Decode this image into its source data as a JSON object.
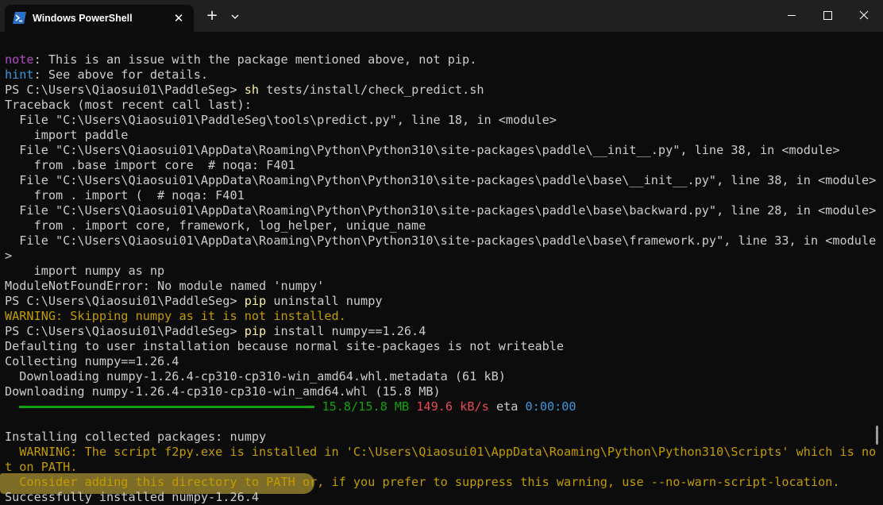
{
  "window": {
    "tab_title": "Windows PowerShell",
    "tab_icon": "powershell-icon",
    "new_tab_label": "+",
    "tab_close_label": "✕",
    "controls": [
      "minimize-icon",
      "maximize-icon",
      "close-icon"
    ]
  },
  "colors": {
    "background": "#0c0c0c",
    "titlebar": "#202020",
    "text": "#cccccc",
    "prompt_keyword": "#f9f1a5",
    "warning": "#c19c00",
    "note": "#b148c6",
    "hint": "#3a96dd",
    "progress": "#13a10e",
    "speed": "#e74856",
    "highlight": "#c4aa3c"
  },
  "terminal": {
    "note_label": "note",
    "note_text": ": This is an issue with the package mentioned above, not pip.",
    "hint_label": "hint",
    "hint_text": ": See above for details.",
    "prompt": "PS C:\\Users\\Qiaosui01\\PaddleSeg> ",
    "cmd1_keyword": "sh",
    "cmd1_args": " tests/install/check_predict.sh",
    "traceback": [
      "Traceback (most recent call last):",
      "  File \"C:\\Users\\Qiaosui01\\PaddleSeg\\tools\\predict.py\", line 18, in <module>",
      "    import paddle",
      "  File \"C:\\Users\\Qiaosui01\\AppData\\Roaming\\Python\\Python310\\site-packages\\paddle\\__init__.py\", line 38, in <module>",
      "    from .base import core  # noqa: F401",
      "  File \"C:\\Users\\Qiaosui01\\AppData\\Roaming\\Python\\Python310\\site-packages\\paddle\\base\\__init__.py\", line 38, in <module>",
      "    from . import (  # noqa: F401",
      "  File \"C:\\Users\\Qiaosui01\\AppData\\Roaming\\Python\\Python310\\site-packages\\paddle\\base\\backward.py\", line 28, in <module>",
      "    from . import core, framework, log_helper, unique_name",
      "  File \"C:\\Users\\Qiaosui01\\AppData\\Roaming\\Python\\Python310\\site-packages\\paddle\\base\\framework.py\", line 33, in <module",
      ">",
      "    import numpy as np",
      "ModuleNotFoundError: No module named 'numpy'"
    ],
    "cmd2_keyword": "pip",
    "cmd2_args": " uninstall numpy",
    "warning_skip": "WARNING: Skipping numpy as it is not installed.",
    "cmd3_keyword": "pip",
    "cmd3_args": " install numpy==1.26.4",
    "install_output": [
      "Defaulting to user installation because normal site-packages is not writeable",
      "Collecting numpy==1.26.4",
      "  Downloading numpy-1.26.4-cp310-cp310-win_amd64.whl.metadata (61 kB)",
      "Downloading numpy-1.26.4-cp310-cp310-win_amd64.whl (15.8 MB)"
    ],
    "progress": {
      "fraction": 1.0,
      "size": "15.8/15.8 MB",
      "speed": "149.6 kB/s",
      "eta_label": "eta",
      "eta": "0:00:00"
    },
    "blank_line": "",
    "installing": "Installing collected packages: numpy",
    "warning_script": [
      "  WARNING: The script f2py.exe is installed in 'C:\\Users\\Qiaosui01\\AppData\\Roaming\\Python\\Python310\\Scripts' which is no",
      "t on PATH.",
      "  Consider adding this directory to PATH or, if you prefer to suppress this warning, use --no-warn-script-location."
    ],
    "success": "Successfully installed numpy-1.26.4"
  }
}
